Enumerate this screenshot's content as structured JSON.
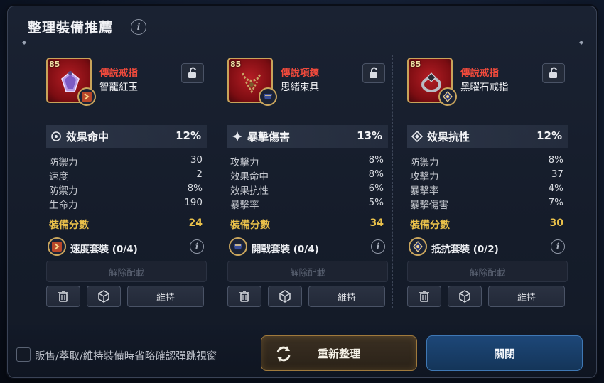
{
  "dialog": {
    "title": "整理裝備推薦",
    "info_icon": "i"
  },
  "items": [
    {
      "level": "85",
      "type": "傳說戒指",
      "name": "智龍紅玉",
      "item_icon": "ring-gem-icon",
      "set_icon": "speed-set-icon",
      "main_stat": {
        "name": "效果命中",
        "value": "12%",
        "icon": "effectiveness-icon"
      },
      "sub_stats": [
        {
          "name": "防禦力",
          "value": "30"
        },
        {
          "name": "速度",
          "value": "2"
        },
        {
          "name": "防禦力",
          "value": "8%"
        },
        {
          "name": "生命力",
          "value": "190"
        }
      ],
      "score_label": "裝備分數",
      "score": "24",
      "set_label": "速度套裝 (0/4)",
      "unequip_label": "解除配載",
      "keep_label": "維持"
    },
    {
      "level": "85",
      "type": "傳說項鍊",
      "name": "思緒束具",
      "item_icon": "necklace-chain-icon",
      "set_icon": "onslaught-set-icon",
      "main_stat": {
        "name": "暴擊傷害",
        "value": "13%",
        "icon": "critical-damage-icon"
      },
      "sub_stats": [
        {
          "name": "攻擊力",
          "value": "8%"
        },
        {
          "name": "效果命中",
          "value": "8%"
        },
        {
          "name": "效果抗性",
          "value": "6%"
        },
        {
          "name": "暴擊率",
          "value": "5%"
        }
      ],
      "score_label": "裝備分數",
      "score": "34",
      "set_label": "開戰套裝 (0/4)",
      "unequip_label": "解除配載",
      "keep_label": "維持"
    },
    {
      "level": "85",
      "type": "傳說戒指",
      "name": "黑曜石戒指",
      "item_icon": "obsidian-ring-icon",
      "set_icon": "resist-set-icon",
      "main_stat": {
        "name": "效果抗性",
        "value": "12%",
        "icon": "effect-resistance-icon"
      },
      "sub_stats": [
        {
          "name": "防禦力",
          "value": "8%"
        },
        {
          "name": "攻擊力",
          "value": "37"
        },
        {
          "name": "暴擊率",
          "value": "4%"
        },
        {
          "name": "暴擊傷害",
          "value": "7%"
        }
      ],
      "score_label": "裝備分數",
      "score": "30",
      "set_label": "抵抗套裝 (0/2)",
      "unequip_label": "解除配載",
      "keep_label": "維持"
    }
  ],
  "footer": {
    "checkbox_label": "販售/萃取/維持裝備時省略確認彈跳視窗",
    "checkbox_checked": false,
    "resort_label": "重新整理",
    "close_label": "關閉"
  },
  "colors": {
    "item_type": "#ef4a3c",
    "score": "#e9c04a",
    "resort_border": "#a07a3c",
    "close_bg": "#1d4778"
  }
}
